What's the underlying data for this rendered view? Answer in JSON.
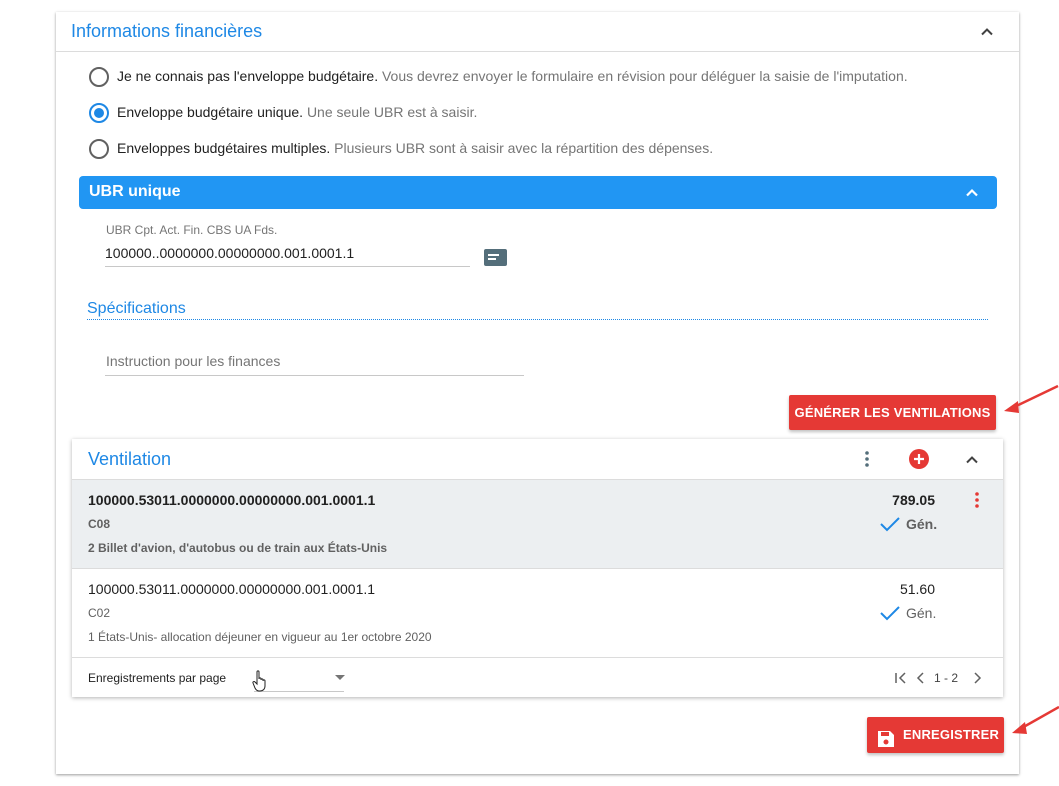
{
  "section": {
    "title": "Informations financières",
    "budget_options": [
      {
        "label": "Je ne connais pas l'enveloppe budgétaire.",
        "hint": "Vous devrez envoyer le formulaire en révision pour déléguer la saisie de l'imputation.",
        "checked": false
      },
      {
        "label": "Enveloppe budgétaire unique.",
        "hint": "Une seule UBR est à saisir.",
        "checked": true
      },
      {
        "label": "Enveloppes budgétaires multiples.",
        "hint": "Plusieurs UBR sont à saisir avec la répartition des dépenses.",
        "checked": false
      }
    ]
  },
  "ubr_panel": {
    "title": "UBR unique",
    "field_label": "UBR Cpt. Act. Fin. CBS UA Fds.",
    "field_value": "100000..0000000.00000000.001.0001.1"
  },
  "specifications": {
    "title": "Spécifications",
    "instruction_placeholder": "Instruction pour les finances"
  },
  "generate_button": "GÉNÉRER LES VENTILATIONS",
  "ventilation": {
    "title": "Ventilation",
    "rows": [
      {
        "ubr": "100000.53011.0000000.00000000.001.0001.1",
        "code": "C08",
        "description": "2 Billet d'avion, d'autobus ou de train aux États-Unis",
        "amount": "789.05",
        "status": "Gén."
      },
      {
        "ubr": "100000.53011.0000000.00000000.001.0001.1",
        "code": "C02",
        "description": "1 États-Unis- allocation déjeuner en vigueur au 1er octobre 2020",
        "amount": "51.60",
        "status": "Gén."
      }
    ],
    "records_per_page_label": "Enregistrements par page",
    "records_per_page_value": "",
    "pagination": "1 - 2"
  },
  "save_button": "ENREGISTRER",
  "colors": {
    "accent": "#1e88e5",
    "panel_blue": "#2196f3",
    "action_red": "#e53935",
    "selected_row": "#eceff1"
  }
}
